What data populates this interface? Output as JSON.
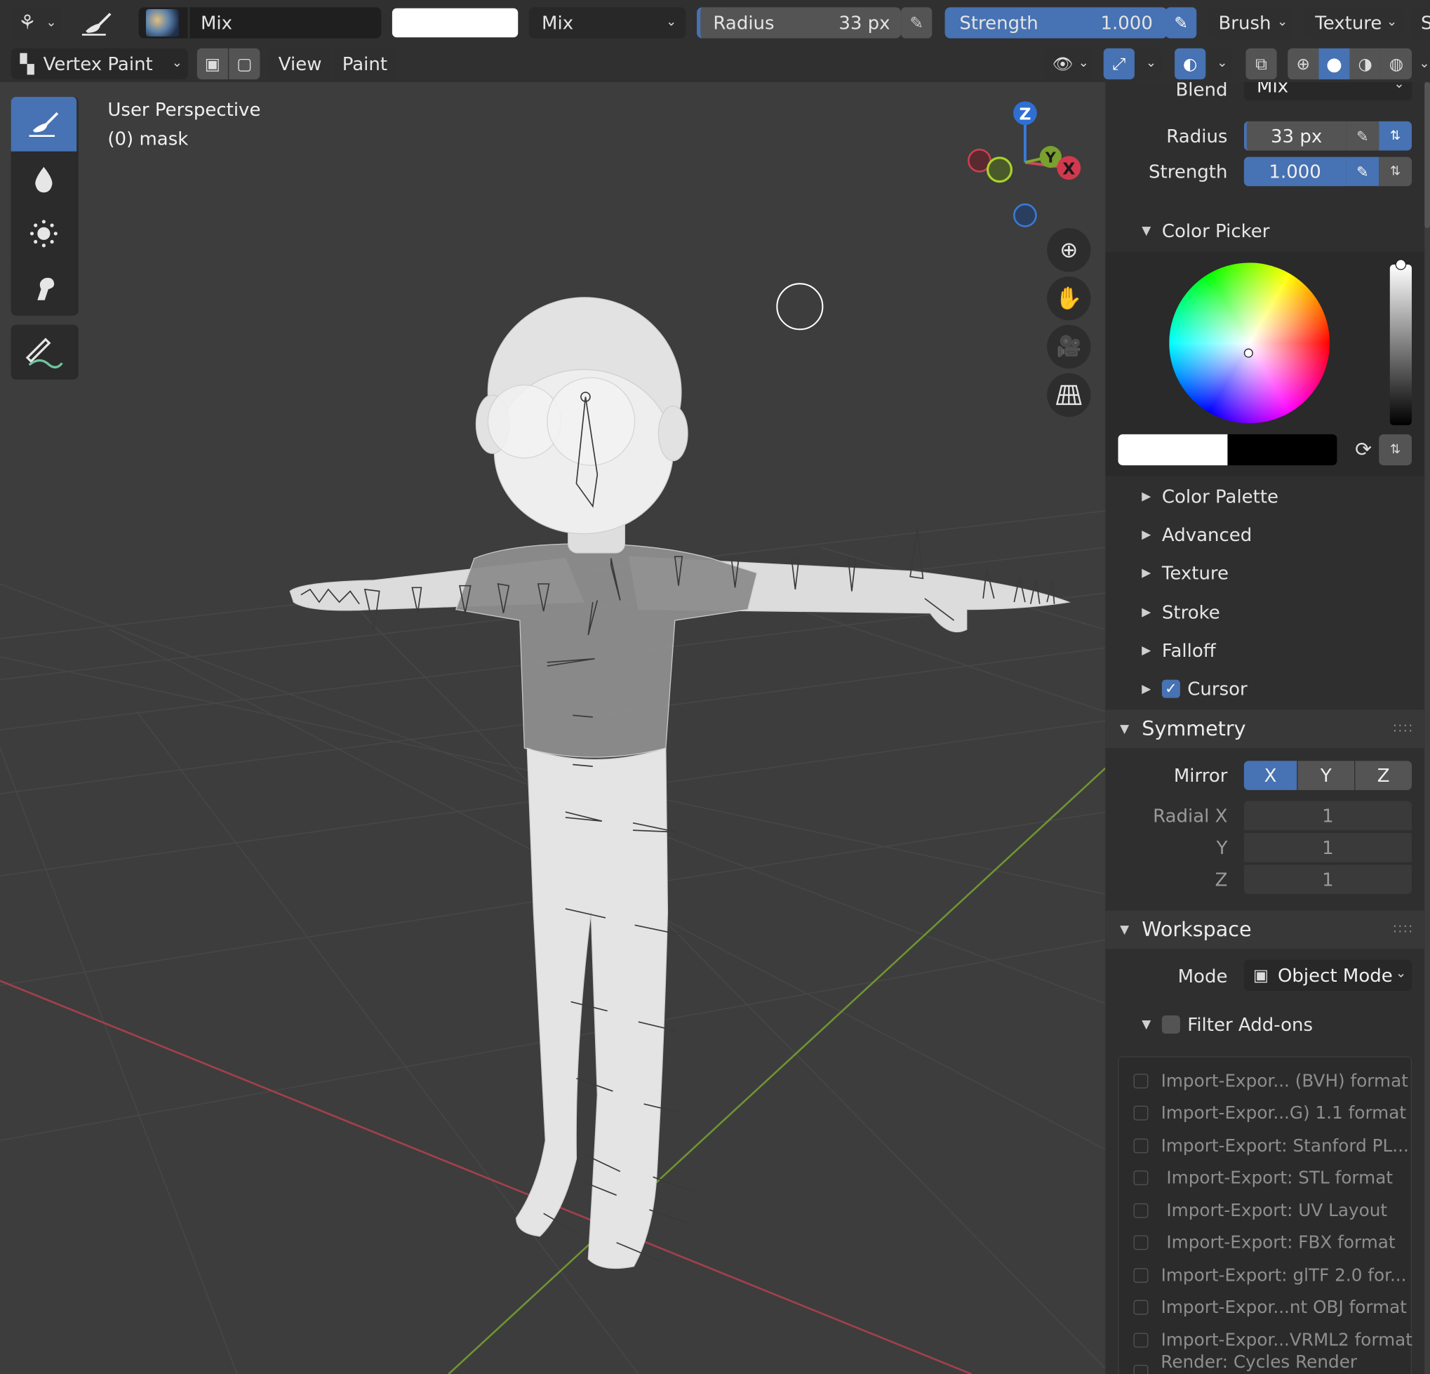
{
  "header": {
    "blend_mode": "Mix",
    "color_blend": "Mix",
    "radius_label": "Radius",
    "radius_value": "33 px",
    "strength_label": "Strength",
    "strength_value": "1.000",
    "brush_menu": "Brush",
    "texture_menu": "Texture",
    "cut_label": "S",
    "mode": "Vertex Paint",
    "view_menu": "View",
    "paint_menu": "Paint",
    "swatch_color": "#ffffff"
  },
  "viewport": {
    "perspective": "User Perspective",
    "object": "(0) mask",
    "gizmo": {
      "z": "Z",
      "y": "Y",
      "x": "X"
    }
  },
  "sidebar": {
    "blend_label": "Blend",
    "blend_value": "Mix",
    "radius_label": "Radius",
    "radius_value": "33 px",
    "strength_label": "Strength",
    "strength_value": "1.000",
    "color_picker": "Color Picker",
    "primary_color": "#ffffff",
    "secondary_color": "#000000",
    "collapsed": [
      "Color Palette",
      "Advanced",
      "Texture",
      "Stroke",
      "Falloff"
    ],
    "cursor_label": "Cursor",
    "cursor_checked": true,
    "symmetry": {
      "title": "Symmetry",
      "mirror_label": "Mirror",
      "axes": [
        "X",
        "Y",
        "Z"
      ],
      "active_axis": "X",
      "radial_x_label": "Radial X",
      "radial_y_label": "Y",
      "radial_z_label": "Z",
      "radial_x": "1",
      "radial_y": "1",
      "radial_z": "1"
    },
    "workspace": {
      "title": "Workspace",
      "mode_label": "Mode",
      "mode_value": "Object Mode",
      "filter_label": "Filter Add-ons",
      "addons": [
        "Import-Expor... (BVH) format",
        "Import-Expor...G) 1.1 format",
        "Import-Export: Stanford PL...",
        "Import-Export: STL format",
        "Import-Export: UV Layout",
        "Import-Export: FBX format",
        "Import-Export: glTF 2.0 for...",
        "Import-Expor...nt OBJ format",
        "Import-Expor...VRML2 format",
        "Render: Cycles Render Engi..."
      ]
    }
  },
  "colors": {
    "accent": "#4772b3",
    "x_axis": "#c9404f",
    "y_axis": "#7aa02f",
    "z_axis": "#2f6fd1"
  }
}
